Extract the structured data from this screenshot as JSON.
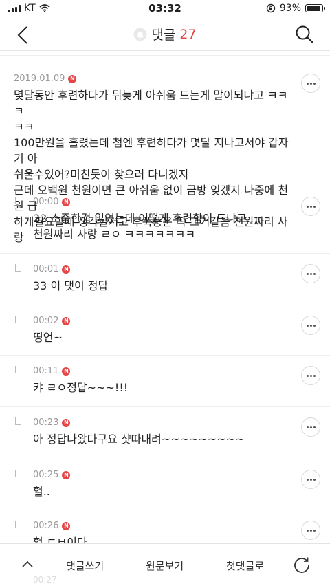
{
  "status_bar": {
    "carrier": "KT",
    "time": "03:32",
    "battery": "93%",
    "battery_level": 0.93,
    "icons": [
      "signal-icon",
      "wifi-icon",
      "rotation-lock-icon",
      "battery-icon"
    ]
  },
  "header": {
    "title": "댓글",
    "count": "27",
    "accent_color": "#e64545",
    "icons": [
      "back-icon",
      "bell-icon",
      "search-icon"
    ]
  },
  "comments": [
    {
      "time": "2019.01.09",
      "badge": "N",
      "text": "몇달동안 후련하다가 뒤늦게 아쉬움 드는게 말이되냐고 ㅋㅋㅋ\nㅋㅋ\n100만원을 흘렸는데 첨엔 후련하다가 몇달 지나고서야 갑자기 아\n쉬울수있어?미친듯이 찾으러 다니겠지\n근데 오백원 천원이면 큰 아쉬움 없이 금방 잊겠지 나중에 천원 급\n하게필요할때 생각날거고 후폭풍은 딱 그거같음 천원짜리 사랑"
    }
  ],
  "replies": [
    {
      "time": "00:00",
      "badge": "N",
      "text": "22 소중한걸 잃었는데 어떻게 후련함이 드냐고..\n천원짜리 사랑 ㄹㅇ ㅋㅋㅋㅋㅋㅋㅋ"
    },
    {
      "time": "00:01",
      "badge": "N",
      "text": "33 이 댓이 정답"
    },
    {
      "time": "00:02",
      "badge": "N",
      "text": "띵언~"
    },
    {
      "time": "00:11",
      "badge": "N",
      "text": "캬 ㄹㅇ정답~~~!!!"
    },
    {
      "time": "00:23",
      "badge": "N",
      "text": "아 정답나왔다구요 샷따내려~~~~~~~~~"
    },
    {
      "time": "00:25",
      "badge": "N",
      "text": "헐.."
    },
    {
      "time": "00:26",
      "badge": "N",
      "text": "헐 ㄷㅂ이다"
    }
  ],
  "bottom_bar": {
    "write": "댓글쓰기",
    "original": "원문보기",
    "first": "첫댓글로",
    "ghost_time": "00:27",
    "icons": [
      "chevron-up-icon",
      "refresh-icon"
    ]
  }
}
